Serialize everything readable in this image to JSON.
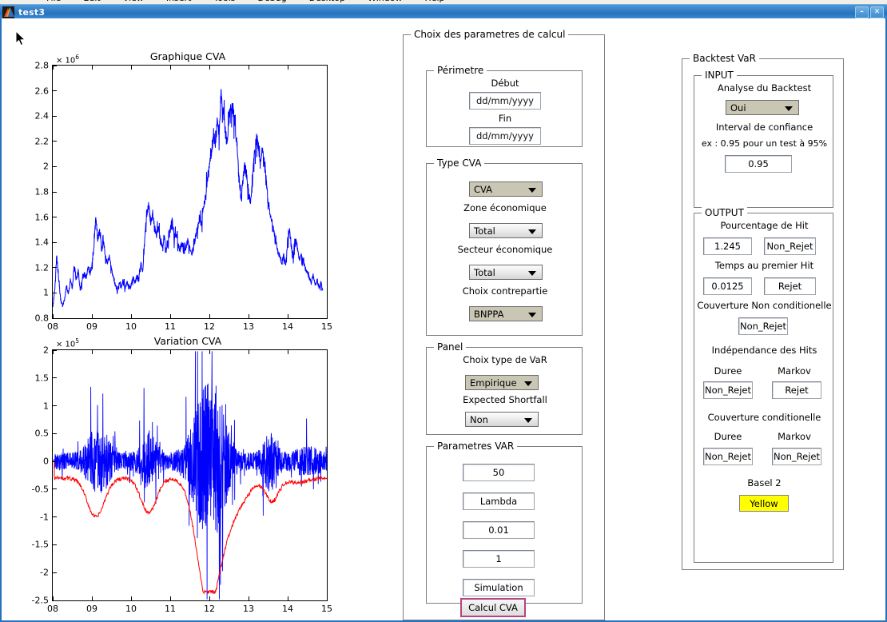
{
  "window": {
    "title": "test3",
    "minimize_label": "–",
    "close_label": "✕",
    "icon_name": "matlab-logo-icon",
    "menu_items": [
      "File",
      "Edit",
      "View",
      "Insert",
      "Tools",
      "Debug",
      "Desktop",
      "Window",
      "Help"
    ]
  },
  "charts": {
    "cva": {
      "title": "Graphique CVA",
      "exponent_text": "× 10",
      "exponent_power": "6",
      "y_ticks": [
        "2.8",
        "2.6",
        "2.4",
        "2.2",
        "2",
        "1.8",
        "1.6",
        "1.4",
        "1.2",
        "1",
        "0.8"
      ],
      "x_ticks": [
        "08",
        "09",
        "10",
        "11",
        "12",
        "13",
        "14",
        "15"
      ]
    },
    "variation": {
      "title": "Variation CVA",
      "exponent_text": "× 10",
      "exponent_power": "5",
      "y_ticks": [
        "2",
        "1.5",
        "1",
        "0.5",
        "0",
        "-0.5",
        "-1",
        "-1.5",
        "-2",
        "-2.5"
      ],
      "x_ticks": [
        "08",
        "09",
        "10",
        "11",
        "12",
        "13",
        "14",
        "15"
      ]
    }
  },
  "chart_data": [
    {
      "type": "line",
      "name": "cva-series",
      "title": "Graphique CVA",
      "xlabel": "",
      "ylabel": "",
      "y_exponent": 1000000,
      "xlim": [
        8,
        15
      ],
      "ylim": [
        0.8,
        2.8
      ],
      "grid": false,
      "legend": "none",
      "series": [
        {
          "name": "CVA",
          "color": "#0000ff",
          "x": [
            8.0,
            8.05,
            8.1,
            8.15,
            8.2,
            8.25,
            8.3,
            8.35,
            8.4,
            8.45,
            8.5,
            8.55,
            8.6,
            8.65,
            8.7,
            8.75,
            8.8,
            8.85,
            8.9,
            8.95,
            9.0,
            9.05,
            9.1,
            9.15,
            9.2,
            9.25,
            9.3,
            9.35,
            9.4,
            9.45,
            9.5,
            9.55,
            9.6,
            9.65,
            9.7,
            9.75,
            9.8,
            9.85,
            9.9,
            9.95,
            10.0,
            10.05,
            10.1,
            10.15,
            10.2,
            10.25,
            10.3,
            10.35,
            10.4,
            10.45,
            10.5,
            10.55,
            10.6,
            10.65,
            10.7,
            10.75,
            10.8,
            10.85,
            10.9,
            10.95,
            11.0,
            11.05,
            11.1,
            11.15,
            11.2,
            11.25,
            11.3,
            11.35,
            11.4,
            11.45,
            11.5,
            11.55,
            11.6,
            11.65,
            11.7,
            11.75,
            11.8,
            11.85,
            11.9,
            11.95,
            12.0,
            12.05,
            12.1,
            12.15,
            12.2,
            12.25,
            12.3,
            12.35,
            12.4,
            12.45,
            12.5,
            12.55,
            12.6,
            12.65,
            12.7,
            12.75,
            12.8,
            12.85,
            12.9,
            12.95,
            13.0,
            13.05,
            13.1,
            13.15,
            13.2,
            13.25,
            13.3,
            13.35,
            13.4,
            13.45,
            13.5,
            13.55,
            13.6,
            13.65,
            13.7,
            13.75,
            13.8,
            13.85,
            13.9,
            13.95,
            14.0,
            14.05,
            14.1,
            14.15,
            14.2,
            14.25,
            14.3,
            14.35,
            14.4,
            14.45,
            14.5,
            14.55,
            14.6,
            14.65,
            14.7,
            14.75,
            14.8,
            14.85,
            14.9,
            14.95,
            15.0
          ],
          "y": [
            0.88,
            1.02,
            1.3,
            1.12,
            0.95,
            0.9,
            0.94,
            1.06,
            0.99,
            1.1,
            1.04,
            1.22,
            1.1,
            1.18,
            1.02,
            1.09,
            1.16,
            1.12,
            1.2,
            1.14,
            1.22,
            1.36,
            1.6,
            1.42,
            1.5,
            1.34,
            1.4,
            1.28,
            1.24,
            1.3,
            1.18,
            1.12,
            1.06,
            1.02,
            1.08,
            1.05,
            1.1,
            1.04,
            1.09,
            1.03,
            1.06,
            1.12,
            1.08,
            1.14,
            1.1,
            1.24,
            1.16,
            1.44,
            1.62,
            1.7,
            1.56,
            1.64,
            1.5,
            1.46,
            1.52,
            1.4,
            1.36,
            1.44,
            1.32,
            1.42,
            1.5,
            1.58,
            1.44,
            1.46,
            1.38,
            1.34,
            1.4,
            1.32,
            1.36,
            1.42,
            1.36,
            1.3,
            1.38,
            1.44,
            1.52,
            1.6,
            1.54,
            1.68,
            1.76,
            1.9,
            2.0,
            2.12,
            2.24,
            2.18,
            2.35,
            2.28,
            2.6,
            2.44,
            2.3,
            2.18,
            2.4,
            2.5,
            2.46,
            2.34,
            2.2,
            1.92,
            1.74,
            1.86,
            2.0,
            1.94,
            1.8,
            1.72,
            1.88,
            2.1,
            2.24,
            2.16,
            2.02,
            2.12,
            2.04,
            1.9,
            1.74,
            1.62,
            1.56,
            1.48,
            1.4,
            1.34,
            1.28,
            1.24,
            1.3,
            1.22,
            1.42,
            1.5,
            1.34,
            1.28,
            1.42,
            1.36,
            1.26,
            1.3,
            1.24,
            1.2,
            1.16,
            1.12,
            1.08,
            1.14,
            1.06,
            1.1,
            1.04,
            1.08,
            1.02
          ]
        }
      ]
    },
    {
      "type": "line",
      "name": "variation-series",
      "title": "Variation CVA",
      "xlabel": "",
      "ylabel": "",
      "y_exponent": 100000,
      "xlim": [
        8,
        15
      ],
      "ylim": [
        -2.5,
        2
      ],
      "grid": false,
      "legend": "none",
      "series": [
        {
          "name": "Variation CVA",
          "color": "#0000ff",
          "description": "High-frequency zero-centred return spikes; largest negative excursion near x=11.9 reaching about -2.2, largest positive spike near x=11.85 reaching above 2."
        },
        {
          "name": "VaR",
          "color": "#ff0000",
          "description": "Smooth negative envelope line; hovers near -0.3 to -1.0, plunging to about -2.3 near x=11.9 then recovering to about -0.3 by x=15."
        }
      ]
    }
  ],
  "calc_panel": {
    "title": "Choix des parametres de calcul",
    "perimetre": {
      "title": "Périmetre",
      "debut_label": "Début",
      "debut_value": "dd/mm/yyyy",
      "fin_label": "Fin",
      "fin_value": "dd/mm/yyyy"
    },
    "type_cva": {
      "title": "Type CVA",
      "type_value": "CVA",
      "zone_label": "Zone économique",
      "zone_value": "Total",
      "secteur_label": "Secteur économique",
      "secteur_value": "Total",
      "contrepartie_label": "Choix contrepartie",
      "contrepartie_value": "BNPPA"
    },
    "panel": {
      "title": "Panel",
      "var_type_label": "Choix type de VaR",
      "var_type_value": "Empirique",
      "es_label": "Expected Shortfall",
      "es_value": "Non"
    },
    "parametres_var": {
      "title": "Parametres VAR",
      "field1": "50",
      "field2": "Lambda",
      "field3": "0.01",
      "field4": "1",
      "field5": "Simulation"
    },
    "calcul_button": "Calcul CVA"
  },
  "backtest": {
    "title": "Backtest VaR",
    "input": {
      "title": "INPUT",
      "analyse_label": "Analyse du Backtest",
      "analyse_value": "Oui",
      "interval_label": "Interval de confiance",
      "interval_hint": "ex : 0.95 pour un test à 95%",
      "interval_value": "0.95"
    },
    "output": {
      "title": "OUTPUT",
      "hit_label": "Pourcentage de Hit",
      "hit_value": "1.245",
      "hit_verdict": "Non_Rejet",
      "temps_label": "Temps au premier Hit",
      "temps_value": "0.0125",
      "temps_verdict": "Rejet",
      "couv_non_cond_label": "Couverture Non conditionelle",
      "couv_non_cond_verdict": "Non_Rejet",
      "independance_label": "Indépendance des Hits",
      "ind_duree_label": "Duree",
      "ind_markov_label": "Markov",
      "ind_duree_verdict": "Non_Rejet",
      "ind_markov_verdict": "Rejet",
      "couv_cond_label": "Couverture conditionelle",
      "cc_duree_label": "Duree",
      "cc_markov_label": "Markov",
      "cc_duree_verdict": "Non_Rejet",
      "cc_markov_verdict": "Non_Rejet",
      "basel_label": "Basel 2",
      "basel_value": "Yellow",
      "basel_color": "#ffff00"
    }
  }
}
